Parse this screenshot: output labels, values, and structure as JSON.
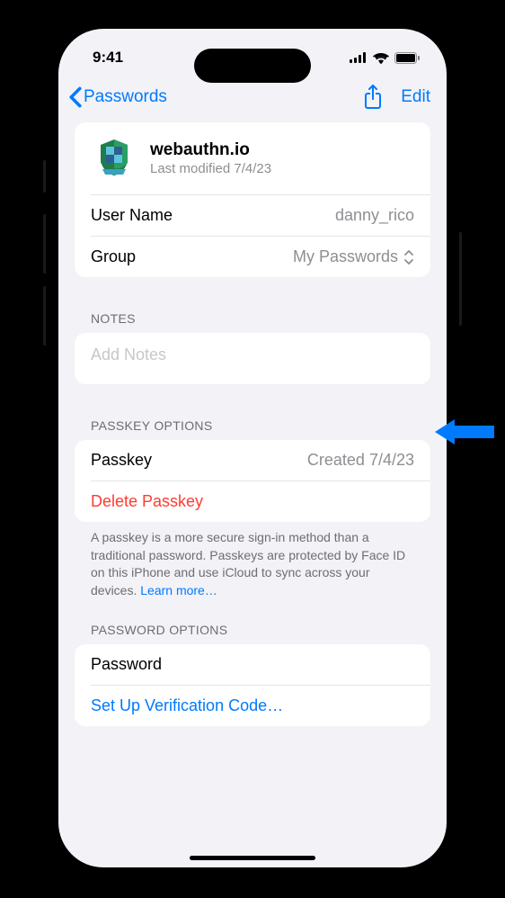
{
  "status": {
    "time": "9:41"
  },
  "nav": {
    "back_label": "Passwords",
    "edit_label": "Edit"
  },
  "site": {
    "name": "webauthn.io",
    "modified": "Last modified 7/4/23"
  },
  "fields": {
    "username_label": "User Name",
    "username_value": "danny_rico",
    "group_label": "Group",
    "group_value": "My Passwords"
  },
  "notes": {
    "section": "NOTES",
    "placeholder": "Add Notes"
  },
  "passkey": {
    "section": "PASSKEY OPTIONS",
    "label": "Passkey",
    "value": "Created 7/4/23",
    "delete_label": "Delete Passkey",
    "footer": "A passkey is a more secure sign-in method than a traditional password. Passkeys are protected by Face ID on this iPhone and use iCloud to sync across your devices. ",
    "learn_more": "Learn more…"
  },
  "password": {
    "section": "PASSWORD OPTIONS",
    "label": "Password",
    "verification_label": "Set Up Verification Code…"
  }
}
